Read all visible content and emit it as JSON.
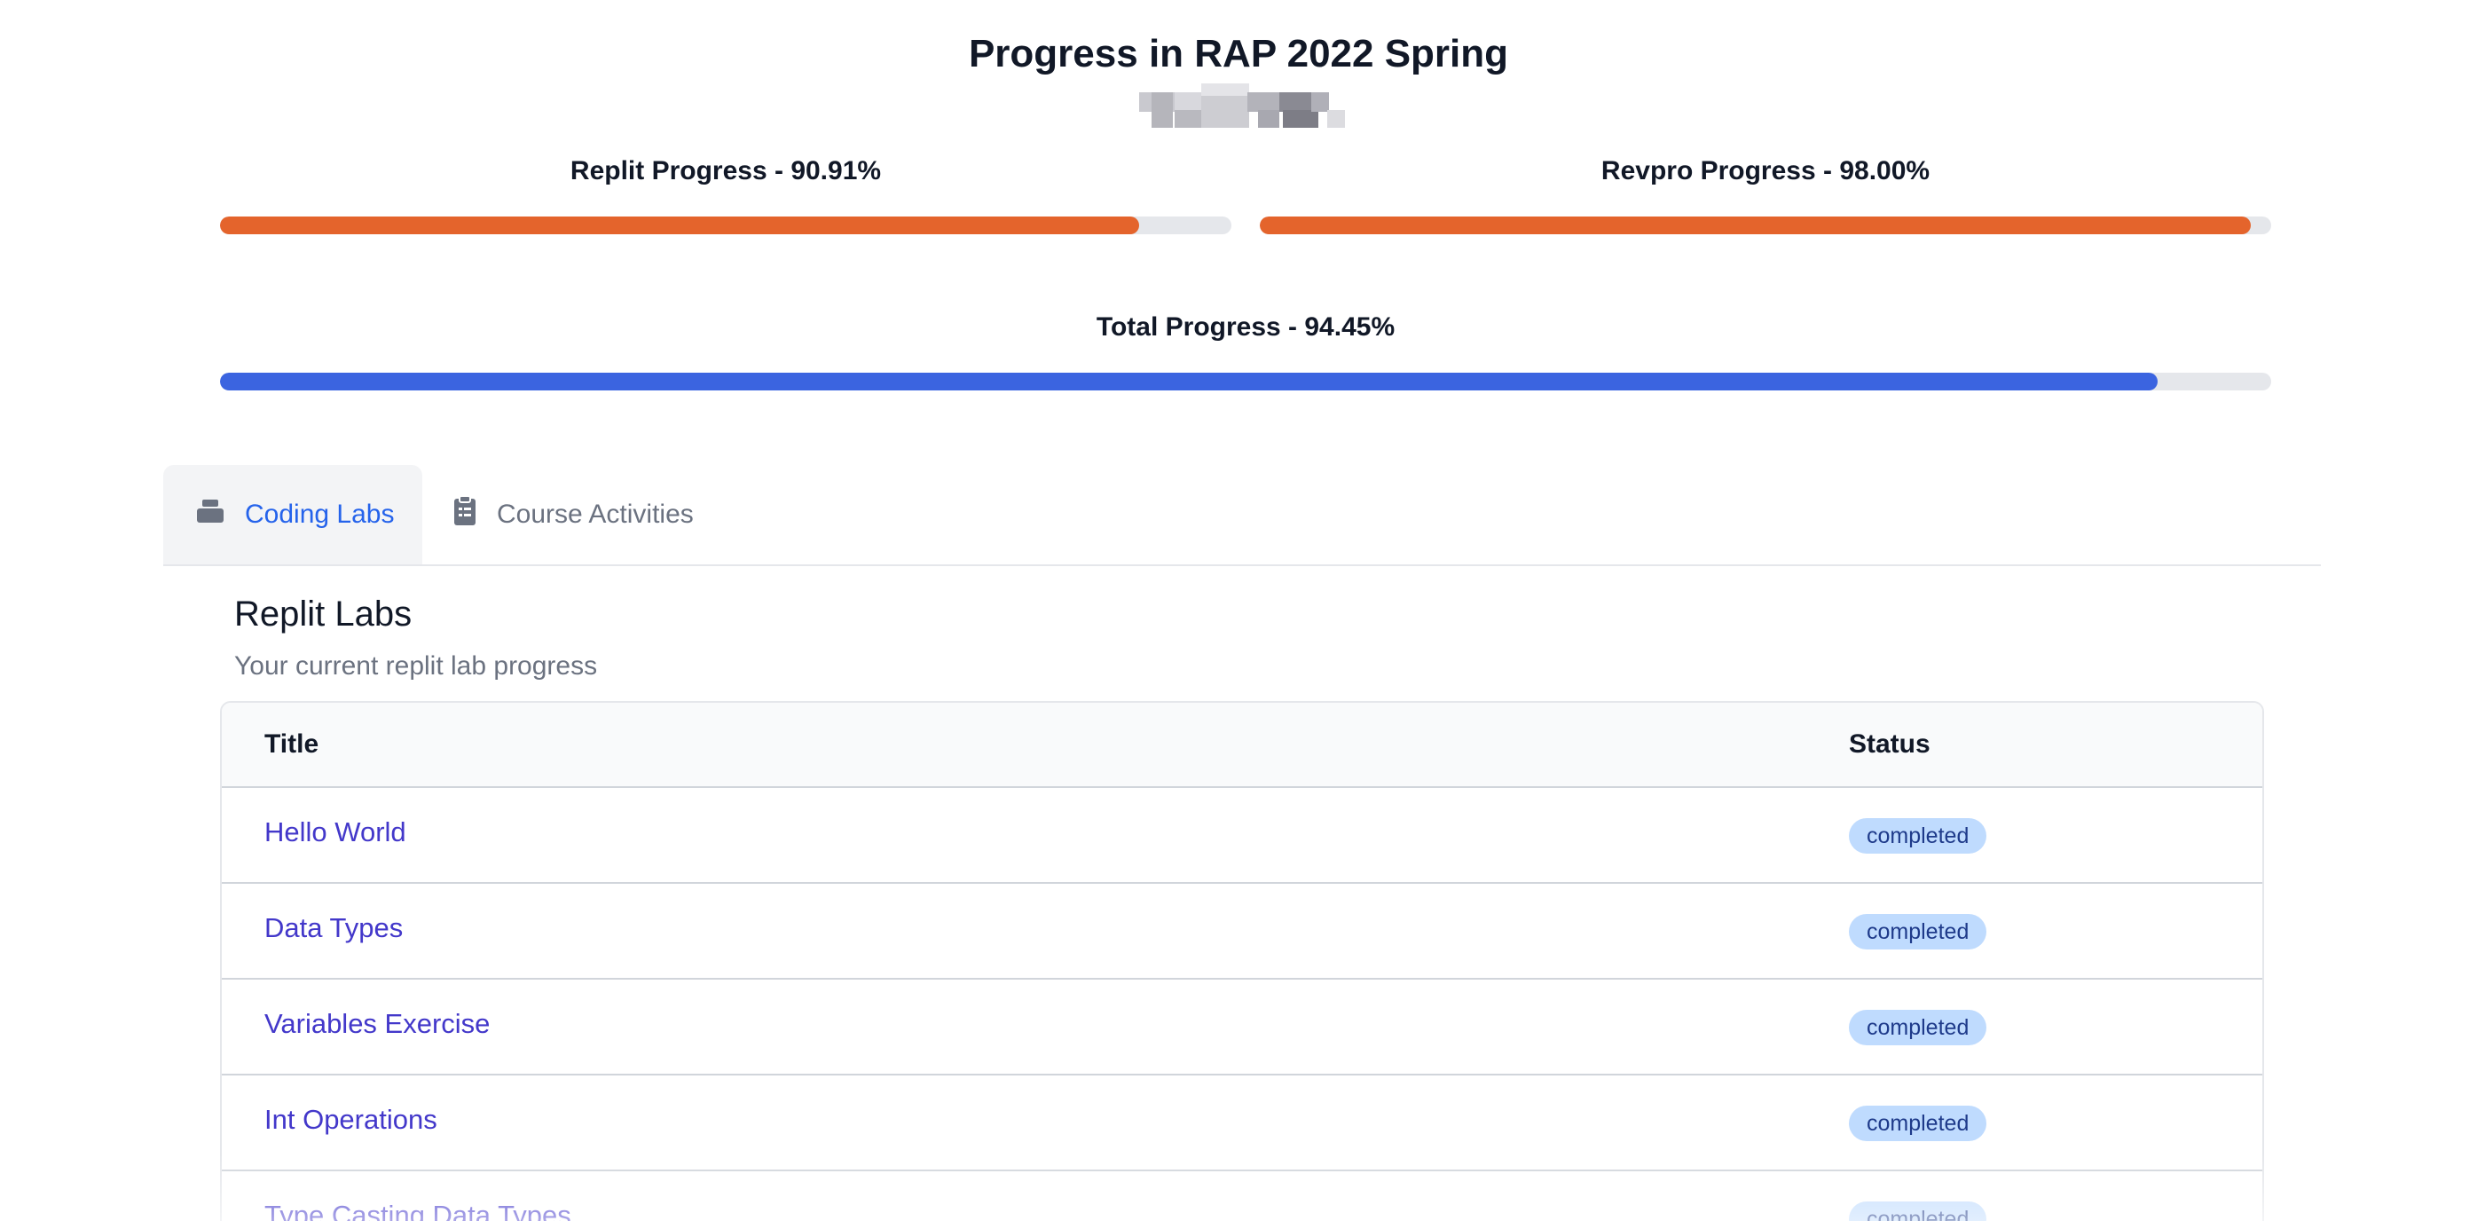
{
  "page": {
    "title": "Progress in RAP 2022 Spring"
  },
  "progress": {
    "replit": {
      "label": "Replit Progress - 90.91%",
      "value": 0.9091,
      "color": "#e4642c"
    },
    "revpro": {
      "label": "Revpro Progress - 98.00%",
      "value": 0.98,
      "color": "#e4642c"
    },
    "total": {
      "label": "Total Progress - 94.45%",
      "value": 0.9445,
      "color": "#3b64e0"
    }
  },
  "tabs": [
    {
      "label": "Coding Labs",
      "icon": "stack-icon",
      "active": true
    },
    {
      "label": "Course Activities",
      "icon": "clipboard-icon",
      "active": false
    }
  ],
  "section": {
    "title": "Replit Labs",
    "subtitle": "Your current replit lab progress"
  },
  "table": {
    "columns": [
      "Title",
      "Status"
    ],
    "rows": [
      {
        "title": "Hello World",
        "status": "completed"
      },
      {
        "title": "Data Types",
        "status": "completed"
      },
      {
        "title": "Variables Exercise",
        "status": "completed"
      },
      {
        "title": "Int Operations",
        "status": "completed"
      },
      {
        "title": "Type Casting Data Types",
        "status": "completed"
      }
    ]
  },
  "colors": {
    "accent": "#2563eb",
    "link": "#4338ca",
    "badge_bg": "#bfdbfe",
    "badge_text": "#1e3a8a"
  }
}
